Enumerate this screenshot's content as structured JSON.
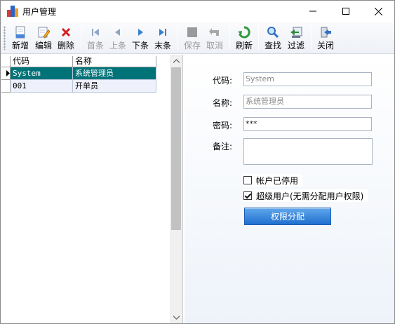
{
  "window": {
    "title": "用户管理"
  },
  "toolbar": {
    "new": "新增",
    "edit": "编辑",
    "delete": "删除",
    "first": "首条",
    "prev": "上条",
    "next": "下条",
    "last": "末条",
    "save": "保存",
    "cancel": "取消",
    "refresh": "刷新",
    "find": "查找",
    "filter": "过滤",
    "close": "关闭"
  },
  "grid": {
    "columns": [
      "代码",
      "名称"
    ],
    "rows": [
      {
        "code": "System",
        "name": "系统管理员",
        "selected": true
      },
      {
        "code": "001",
        "name": "开单员",
        "selected": false
      }
    ]
  },
  "form": {
    "code_label": "代码:",
    "code_value": "System",
    "name_label": "名称:",
    "name_value": "系统管理员",
    "password_label": "密码:",
    "password_value": "***",
    "remark_label": "备注:",
    "remark_value": "",
    "disabled_label": "帐户已停用",
    "disabled_checked": false,
    "superuser_label": "超级用户(无需分配用户权限)",
    "superuser_checked": true,
    "permission_button": "权限分配"
  },
  "colors": {
    "selected_row": "#007378",
    "button_blue": "#2f7fd8",
    "delete_red": "#d32020",
    "nav_blue": "#3a7fd0",
    "refresh_green": "#2e9a3a"
  }
}
